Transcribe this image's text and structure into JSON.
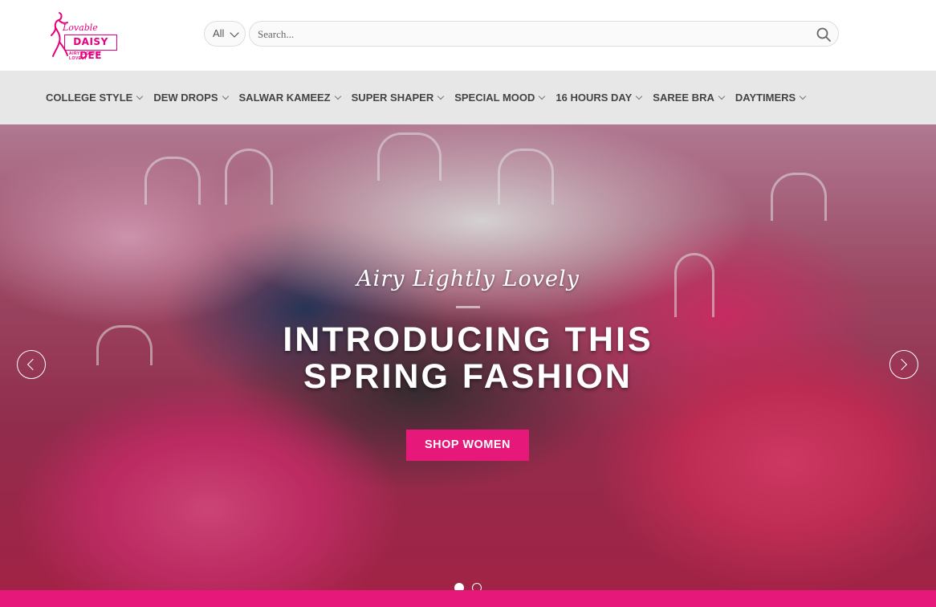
{
  "header": {
    "logo": {
      "brand_top": "Lovable",
      "brand_main": "DAISY DEE",
      "tagline": "AIRY LIGHTLY LOVELY"
    },
    "category_select": {
      "value": "All"
    },
    "search": {
      "placeholder": "Search..."
    }
  },
  "nav": {
    "items": [
      {
        "label": "COLLEGE STYLE"
      },
      {
        "label": "DEW DROPS"
      },
      {
        "label": "SALWAR KAMEEZ"
      },
      {
        "label": "SUPER SHAPER"
      },
      {
        "label": "SPECIAL MOOD"
      },
      {
        "label": "16 HOURS DAY"
      },
      {
        "label": "SAREE BRA"
      },
      {
        "label": "DAYTIMERS"
      }
    ]
  },
  "hero": {
    "script": "Airy Lightly Lovely",
    "title_line1": "INTRODUCING THIS",
    "title_line2": "SPRING FASHION",
    "button": "SHOP WOMEN",
    "slides": 2,
    "active_slide": 1
  },
  "colors": {
    "accent": "#e6187a",
    "nav_bg": "#e7e7e7"
  },
  "icons": [
    "search-icon",
    "chevron-down-icon",
    "arrow-left-icon",
    "arrow-right-icon"
  ]
}
